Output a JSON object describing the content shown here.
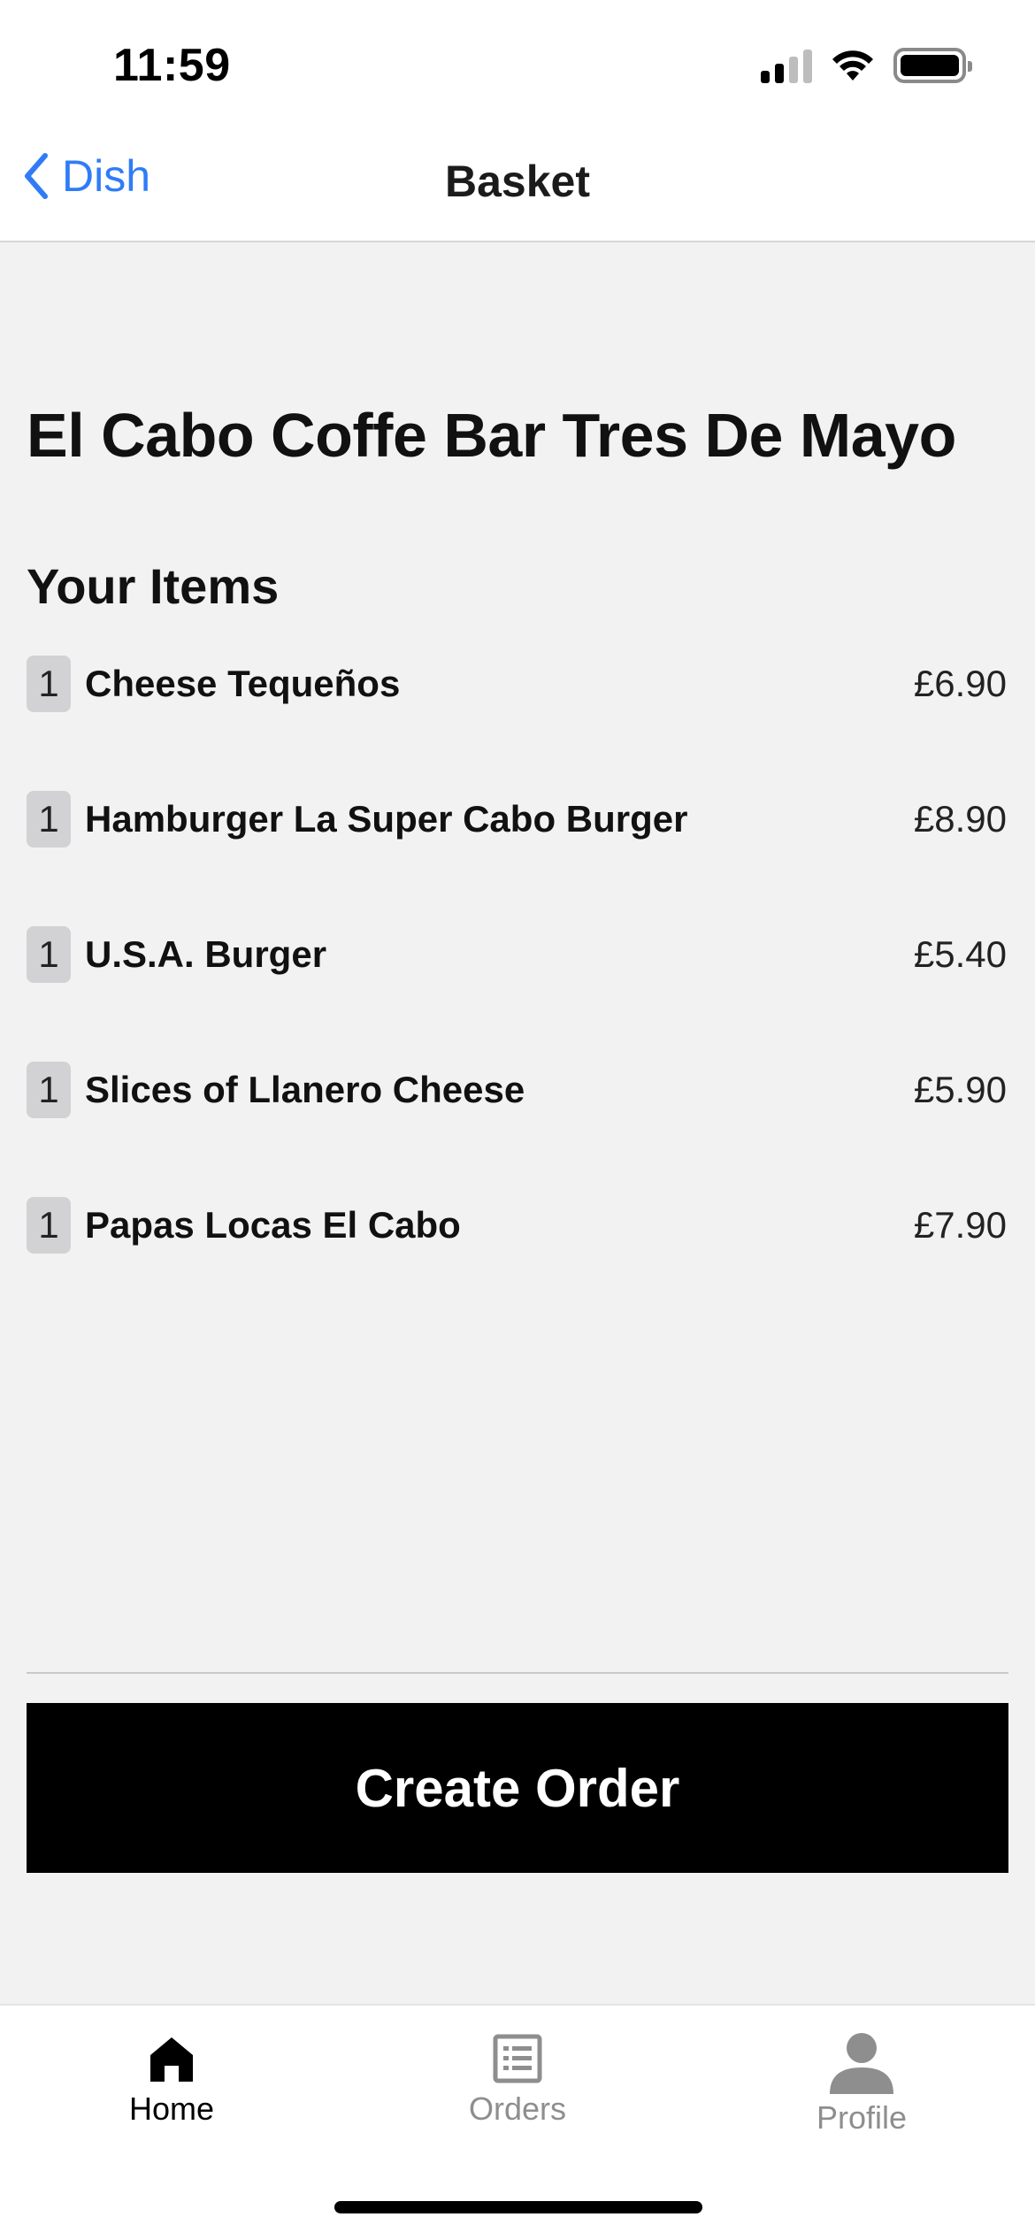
{
  "status_bar": {
    "time": "11:59"
  },
  "nav": {
    "back_label": "Dish",
    "title": "Basket"
  },
  "restaurant_name": "El Cabo Coffe Bar Tres De Mayo",
  "items_heading": "Your Items",
  "items": [
    {
      "qty": "1",
      "name": "Cheese Tequeños",
      "price": "£6.90"
    },
    {
      "qty": "1",
      "name": "Hamburger La Super Cabo Burger",
      "price": "£8.90"
    },
    {
      "qty": "1",
      "name": "U.S.A. Burger",
      "price": "£5.40"
    },
    {
      "qty": "1",
      "name": "Slices of Llanero Cheese",
      "price": "£5.90"
    },
    {
      "qty": "1",
      "name": "Papas Locas El Cabo",
      "price": "£7.90"
    }
  ],
  "create_order_label": "Create Order",
  "tabs": [
    {
      "label": "Home",
      "icon": "home-icon",
      "active": true
    },
    {
      "label": "Orders",
      "icon": "list-icon",
      "active": false
    },
    {
      "label": "Profile",
      "icon": "person-icon",
      "active": false
    }
  ],
  "colors": {
    "accent": "#2f7cf6",
    "button": "#000000",
    "background": "#f2f2f2",
    "inactive_tab": "#8e8e8e"
  }
}
